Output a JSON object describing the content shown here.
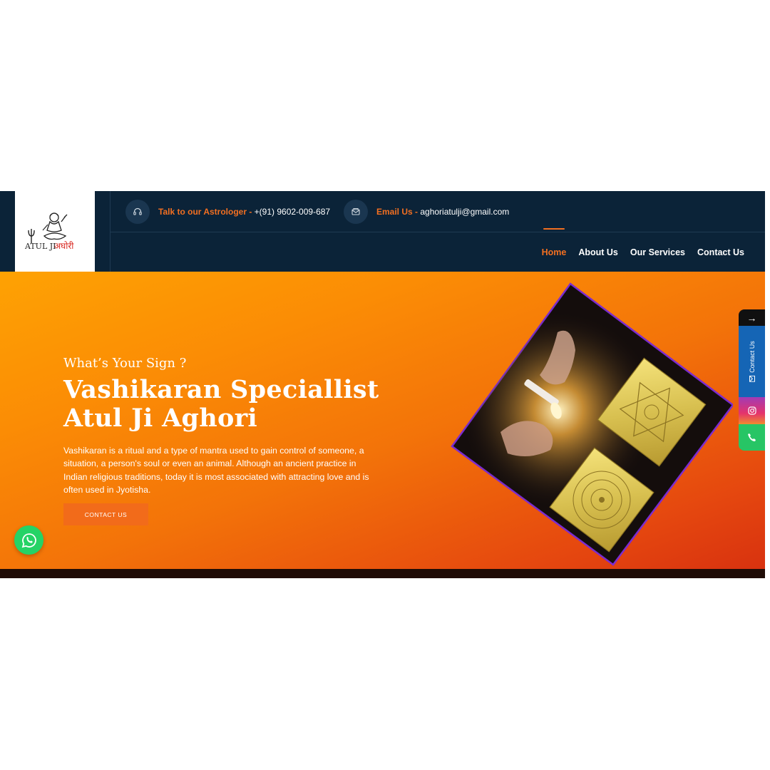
{
  "brand": {
    "logo_text_latin": "ATUL JI",
    "logo_text_hindi": "अघोरी"
  },
  "topbar": {
    "phone": {
      "label": "Talk to our Astrologer - ",
      "value": "+(91) 9602-009-687",
      "icon": "headset-icon"
    },
    "email": {
      "label": "Email Us - ",
      "value": "aghoriatulji@gmail.com",
      "icon": "mail-icon"
    }
  },
  "nav": {
    "items": [
      {
        "label": "Home",
        "active": true
      },
      {
        "label": "About Us",
        "active": false
      },
      {
        "label": "Our Services",
        "active": false
      },
      {
        "label": "Contact Us",
        "active": false
      }
    ]
  },
  "hero": {
    "subtitle": "What’s Your Sign ?",
    "title_line1": "Vashikaran Speciallist",
    "title_line2": "Atul Ji Aghori",
    "description": "Vashikaran is a ritual and a type of mantra used to gain control of someone, a situation, a person's soul or even an animal. Although an ancient practice in Indian religious traditions, today it is most associated with attracting love and is often used in Jyotisha.",
    "cta_label": "CONTACT US"
  },
  "side_bar": {
    "toggle_icon": "arrow-right-icon",
    "contact_label": "Contact Us",
    "contact_icon": "envelope-icon",
    "instagram_icon": "instagram-icon",
    "phone_icon": "phone-icon"
  },
  "floating": {
    "whatsapp_icon": "whatsapp-icon"
  },
  "colors": {
    "header_bg": "#0b2338",
    "accent": "#f26f21",
    "hero_gradient_start": "#fea203",
    "hero_gradient_end": "#d8320f",
    "side_contact": "#1565b5",
    "whatsapp": "#25d366"
  }
}
